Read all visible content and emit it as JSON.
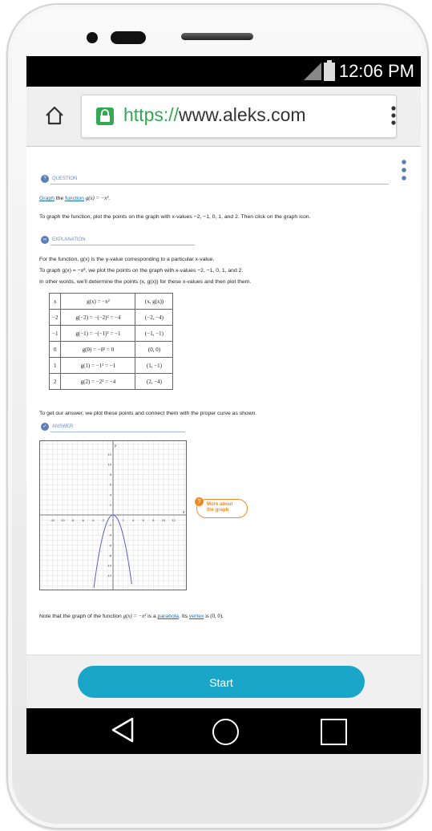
{
  "status": {
    "time": "12:06 PM"
  },
  "browser": {
    "url_protocol": "https://",
    "url_host": "www.aleks.com"
  },
  "question": {
    "label": "QUESTION",
    "line1_link1": "Graph",
    "line1_mid": " the ",
    "line1_link2": "function",
    "line1_math": "g(x) = −x².",
    "instruction": "To graph the function, plot the points on the graph with x-values −2, −1, 0, 1, and 2. Then click on the graph icon."
  },
  "explanation": {
    "label": "EXPLANATION",
    "p1": "For the function, g(x) is the y-value corresponding to a particular x-value.",
    "p2": "To graph g(x) = −x², we plot the points on the graph with x-values −2, −1, 0, 1, and 2.",
    "p3": "In other words, we'll determine the points (x, g(x)) for these x-values and then plot them.",
    "table": {
      "headers": [
        "x",
        "g(x) = −x²",
        "(x, g(x))"
      ],
      "rows": [
        [
          "−2",
          "g(−2) = −(−2)² = −4",
          "(−2, −4)"
        ],
        [
          "−1",
          "g(−1) = −(−1)² = −1",
          "(−1, −1)"
        ],
        [
          "0",
          "g(0) = −0² = 0",
          "(0, 0)"
        ],
        [
          "1",
          "g(1) = −1² = −1",
          "(1, −1)"
        ],
        [
          "2",
          "g(2) = −2² = −4",
          "(2, −4)"
        ]
      ]
    },
    "p4": "To get our answer, we plot these points and connect them with the proper curve as shown."
  },
  "answer": {
    "label": "ANSWER",
    "x_ticks": [
      "-12",
      "-10",
      "-8",
      "-6",
      "-4",
      "-2",
      "2",
      "4",
      "6",
      "8",
      "10",
      "12"
    ],
    "y_ticks": [
      "12",
      "10",
      "8",
      "6",
      "4",
      "2",
      "-2",
      "-4",
      "-6",
      "-8",
      "-10",
      "-12"
    ],
    "axis_x": "x",
    "axis_y": "y",
    "more_about_line1": "More about",
    "more_about_line2": "the graph",
    "note_pre": "Note that the graph of the function ",
    "note_math": "g(x) = −x²",
    "note_mid": " is a ",
    "note_link1": "parabola",
    "note_mid2": ". Its ",
    "note_link2": "vertex",
    "note_end": " is (0, 0)."
  },
  "footer": {
    "start_label": "Start"
  },
  "colors": {
    "accent": "#1aa6c8",
    "link": "#1a6fb0",
    "orange": "#f08a24",
    "curve": "#5b5fc7"
  }
}
